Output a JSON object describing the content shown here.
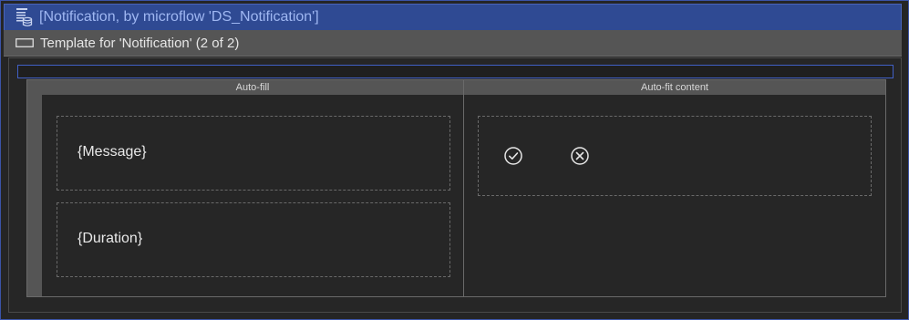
{
  "dataview": {
    "title": "[Notification, by microflow 'DS_Notification']",
    "icon": "dataview-database-icon"
  },
  "template": {
    "title": "Template for 'Notification' (2 of 2)",
    "icon": "template-icon"
  },
  "layout_grid": {
    "columns": [
      {
        "label": "Auto-fill"
      },
      {
        "label": "Auto-fit content"
      }
    ]
  },
  "fields": [
    {
      "label": "{Message}"
    },
    {
      "label": "{Duration}"
    }
  ],
  "actions": [
    {
      "icon": "check-circle-icon"
    },
    {
      "icon": "close-circle-icon"
    }
  ],
  "colors": {
    "header_bg": "#2f4a93",
    "header_text": "#9fb7f2",
    "template_bg": "#555555",
    "canvas_bg": "#252525",
    "blue_border": "#4160c5"
  }
}
